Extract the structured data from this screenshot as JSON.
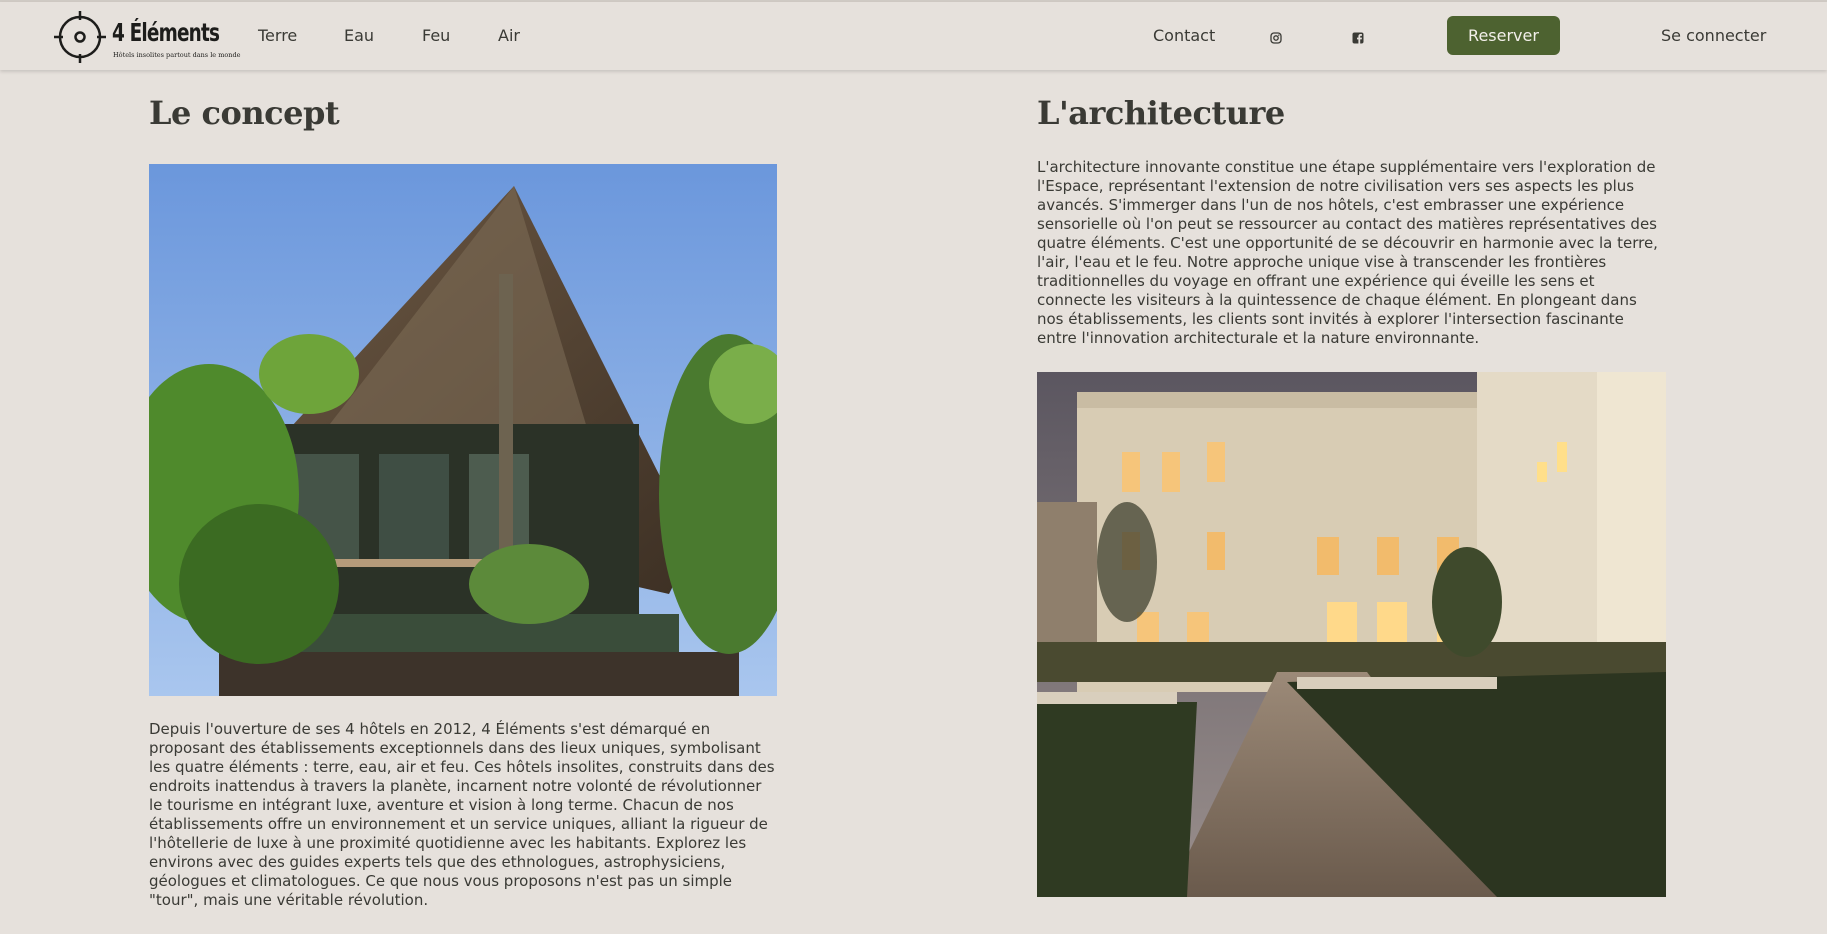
{
  "header": {
    "brand": "4 Éléments",
    "tagline": "Hôtels insolites partout dans le monde",
    "nav": [
      "Terre",
      "Eau",
      "Feu",
      "Air"
    ],
    "contact": "Contact",
    "instagram_icon": "instagram-icon",
    "facebook_icon": "facebook-icon",
    "reserve": "Reserver",
    "login": "Se connecter",
    "accent": "#4d6230"
  },
  "concept": {
    "title": "Le concept",
    "image_alt": "Bungalow avec un toit de chaume entouré de végétation",
    "text": "Depuis l'ouverture de ses 4 hôtels en 2012, 4 Éléments s'est démarqué en proposant des établissements exceptionnels dans des lieux uniques, symbolisant les quatre éléments : terre, eau, air et feu. Ces hôtels insolites, construits dans des endroits inattendus à travers la planète, incarnent notre volonté de révolutionner le tourisme en intégrant luxe, aventure et vision à long terme. Chacun de nos établissements offre un environnement et un service uniques, alliant la rigueur de l'hôtellerie de luxe à une proximité quotidienne avec les habitants. Explorez les environs avec des guides experts tels que des ethnologues, astrophysiciens, géologues et climatologues. Ce que nous vous proposons n'est pas un simple \"tour\", mais une véritable révolution."
  },
  "architecture": {
    "title": "L'architecture",
    "text": "L'architecture innovante constitue une étape supplémentaire vers l'exploration de l'Espace, représentant l'extension de notre civilisation vers ses aspects les plus avancés. S'immerger dans l'un de nos hôtels, c'est embrasser une expérience sensorielle où l'on peut se ressourcer au contact des matières représentatives des quatre éléments. C'est une opportunité de se découvrir en harmonie avec la terre, l'air, l'eau et le feu. Notre approche unique vise à transcender les frontières traditionnelles du voyage en offrant une expérience qui éveille les sens et connecte les visiteurs à la quintessence de chaque élément. En plongeant dans nos établissements, les clients sont invités à explorer l'intersection fascinante entre l'innovation architecturale et la nature environnante.",
    "image_alt": "Façade d'un hôtel classique illuminée au crépuscule avec jardin"
  }
}
